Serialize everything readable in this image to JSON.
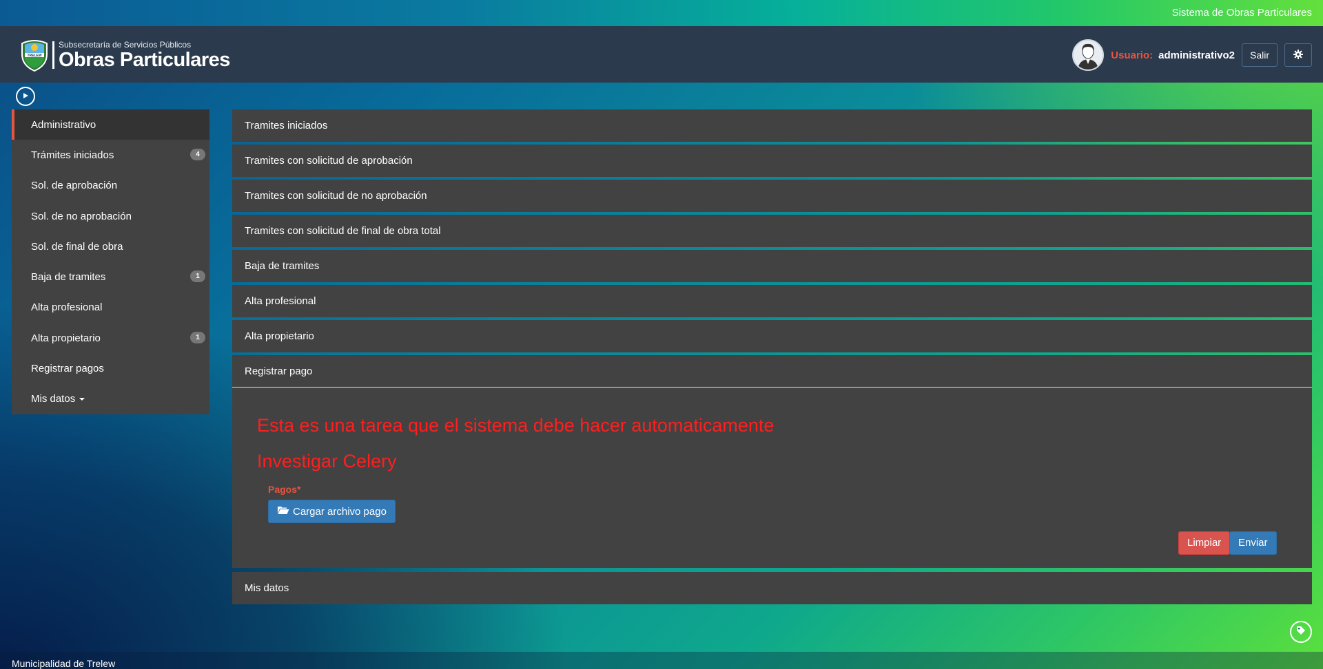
{
  "topbar": {
    "system_title": "Sistema de Obras Particulares"
  },
  "header": {
    "logo_subtitle": "Subsecretaría de Servicios Públicos",
    "logo_title": "Obras Particulares",
    "logo_badge_text": "TRELEW",
    "user_label": "Usuario:",
    "user_name": "administrativo2",
    "logout_label": "Salir"
  },
  "sidebar": {
    "items": [
      {
        "label": "Administrativo",
        "badge": null,
        "active": true
      },
      {
        "label": "Trámites iniciados",
        "badge": "4"
      },
      {
        "label": "Sol. de aprobación",
        "badge": null
      },
      {
        "label": "Sol. de no aprobación",
        "badge": null
      },
      {
        "label": "Sol. de final de obra",
        "badge": null
      },
      {
        "label": "Baja de tramites",
        "badge": "1"
      },
      {
        "label": "Alta profesional",
        "badge": null
      },
      {
        "label": "Alta propietario",
        "badge": "1"
      },
      {
        "label": "Registrar pagos",
        "badge": null
      },
      {
        "label": "Mis datos",
        "badge": null
      }
    ]
  },
  "panels": {
    "titles": [
      "Tramites iniciados",
      "Tramites con solicitud de aprobación",
      "Tramites con solicitud de no aprobación",
      "Tramites con solicitud de final de obra total",
      "Baja de tramites",
      "Alta profesional",
      "Alta propietario",
      "Registrar pago",
      "Mis datos"
    ],
    "registrar_pago": {
      "note_line1": "Esta es una tarea que el sistema debe hacer automaticamente",
      "note_line2": "Investigar Celery",
      "field_label": "Pagos*",
      "upload_label": "Cargar archivo pago",
      "clear_label": "Limpiar",
      "submit_label": "Enviar"
    }
  },
  "footer": {
    "text": "Municipalidad de Trelew"
  },
  "colors": {
    "header_bg": "#2b3a4c",
    "panel_bg": "#424242",
    "accent_red": "#e8553f",
    "note_red": "#ff1f1f",
    "primary_blue": "#337ab7",
    "danger_red": "#d9534f"
  }
}
